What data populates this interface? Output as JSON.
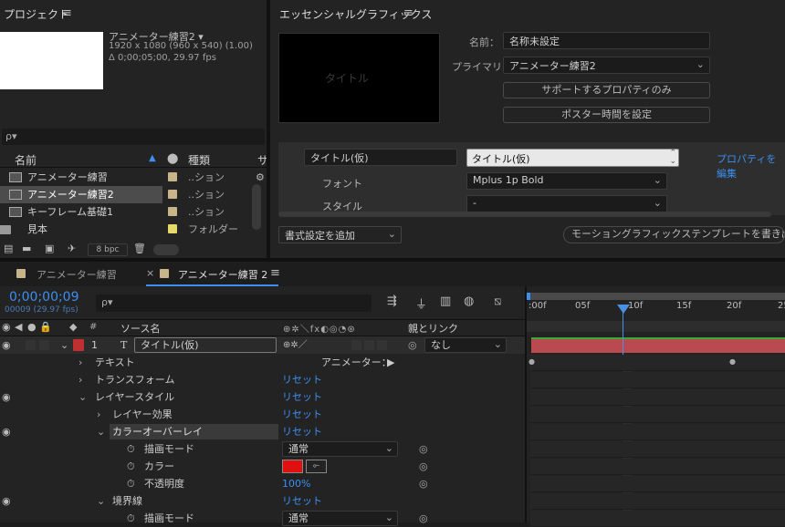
{
  "project": {
    "title": "プロジェクト",
    "menu_icon": "≡",
    "comp_name": "アニメーター練習2 ▾",
    "comp_res": "1920 x 1080  (960 x 540) (1.00)",
    "comp_dur": "Δ 0;00;05;00, 29.97 fps",
    "search_placeholder": "ρ▾",
    "col_name": "名前",
    "col_type": "種類",
    "col_extra": "サ",
    "items": [
      {
        "name": "アニメーター練習",
        "type": "..ション",
        "color": "#c7b489",
        "icon": "comp-icon"
      },
      {
        "name": "アニメーター練習2",
        "type": "..ション",
        "color": "#c7b489",
        "icon": "comp-icon"
      },
      {
        "name": "キーフレーム基礎1",
        "type": "..ション",
        "color": "#c7b489",
        "icon": "comp-icon"
      },
      {
        "name": "見本",
        "type": "フォルダー",
        "color": "#e6d86b",
        "icon": "folder-icon"
      }
    ],
    "bpc": "8 bpc"
  },
  "egfx": {
    "title": "エッセンシャルグラフィックス",
    "menu_icon": "≡",
    "preview_text": "タイトル",
    "name_label": "名前：",
    "name_value": "名称未設定",
    "primary_label": "プライマリ：",
    "primary_value": "アニメーター練習2",
    "btn_props": "サポートするプロパティのみ",
    "btn_poster": "ポスター時間を設定",
    "prop_label": "タイトル(仮)",
    "prop_value": "タイトル(仮)",
    "edit_link": "プロパティを編集",
    "font_label": "フォント",
    "font_value": "Mplus 1p Bold",
    "style_label": "スタイル",
    "style_value": "-",
    "add_format": "書式設定を追加",
    "export_btn": "モーショングラフィックステンプレートを書き出し..."
  },
  "timeline": {
    "tab1": "アニメーター練習",
    "tab2": "アニメーター練習 2",
    "close_icon": "×",
    "menu_icon": "≡",
    "timecode": "0;00;00;09",
    "frames": "00009 (29.97 fps)",
    "col_num": "#",
    "col_source": "ソース名",
    "col_parent": "親とリンク",
    "ruler": [
      ":00f",
      "05f",
      "10f",
      "15f",
      "20f",
      "25"
    ],
    "layer": {
      "num": "1",
      "type": "T",
      "name": "タイトル(仮)",
      "parent": "なし",
      "color": "#c03030"
    },
    "rows": [
      {
        "label": "テキスト",
        "indent": 1,
        "value": "アニメーター：",
        "value_link": false
      },
      {
        "label": "トランスフォーム",
        "indent": 1,
        "value": "リセット",
        "value_link": true
      },
      {
        "label": "レイヤースタイル",
        "indent": 1,
        "value": "リセット",
        "value_link": true
      },
      {
        "label": "レイヤー効果",
        "indent": 2,
        "value": "リセット",
        "value_link": true
      },
      {
        "label": "カラーオーバーレイ",
        "indent": 2,
        "value": "リセット",
        "value_link": true
      },
      {
        "label": "描画モード",
        "indent": 3,
        "value": "通常",
        "value_link": false
      },
      {
        "label": "カラー",
        "indent": 3,
        "value": "",
        "value_link": false
      },
      {
        "label": "不透明度",
        "indent": 3,
        "value": "100%",
        "value_link": true
      },
      {
        "label": "境界線",
        "indent": 2,
        "value": "リセット",
        "value_link": true
      },
      {
        "label": "描画モード",
        "indent": 3,
        "value": "通常",
        "value_link": false
      }
    ],
    "overlay_color": "#e01010",
    "bar_color": "#b84a50",
    "playhead_color": "#4a90e2"
  }
}
